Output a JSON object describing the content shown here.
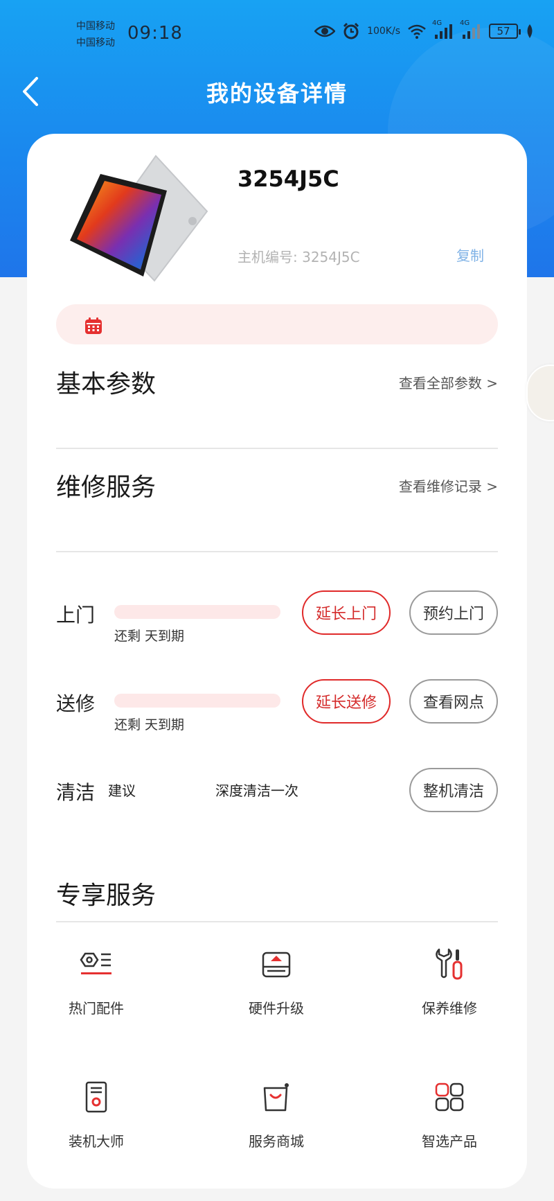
{
  "status_bar": {
    "carrier1": "中国移动",
    "carrier2": "中国移动",
    "time": "09:18",
    "net_speed_value": "100",
    "net_speed_unit": "K/s",
    "network1": "4G",
    "network2": "4G",
    "battery": "57",
    "icons": [
      "eye-icon",
      "alarm-icon",
      "wifi-icon",
      "signal-icon",
      "signal-icon",
      "battery-icon",
      "leaf-icon"
    ]
  },
  "nav": {
    "title": "我的设备详情",
    "back_icon": "chevron-left-icon"
  },
  "device": {
    "name": "3254J5C",
    "serial_label": "主机编号: 3254J5C",
    "copy_label": "复制"
  },
  "sections": {
    "basic": {
      "title": "基本参数",
      "link": "查看全部参数 >"
    },
    "repair": {
      "title": "维修服务",
      "link": "查看维修记录 >"
    },
    "exclusive": {
      "title": "专享服务"
    }
  },
  "services": {
    "onsite": {
      "label": "上门",
      "remain": "还剩 天到期",
      "primary_btn": "延长上门",
      "secondary_btn": "预约上门"
    },
    "carry_in": {
      "label": "送修",
      "remain": "还剩 天到期",
      "primary_btn": "延长送修",
      "secondary_btn": "查看网点"
    },
    "cleaning": {
      "label": "清洁",
      "suggest": "建议",
      "suggest_text": "深度清洁一次",
      "btn": "整机清洁"
    }
  },
  "exclusive_items": [
    {
      "label": "热门配件",
      "icon": "parts-icon"
    },
    {
      "label": "硬件升级",
      "icon": "hardware-icon"
    },
    {
      "label": "保养维修",
      "icon": "repair-tools-icon"
    },
    {
      "label": "装机大师",
      "icon": "install-icon"
    },
    {
      "label": "服务商城",
      "icon": "shopping-bag-icon"
    },
    {
      "label": "智选产品",
      "icon": "grid-apps-icon"
    }
  ],
  "colors": {
    "accent_blue": "#1a8cf0",
    "accent_red": "#e02a2a",
    "progress_bg": "#fde8e8",
    "copy_blue": "#7fb2e6"
  }
}
